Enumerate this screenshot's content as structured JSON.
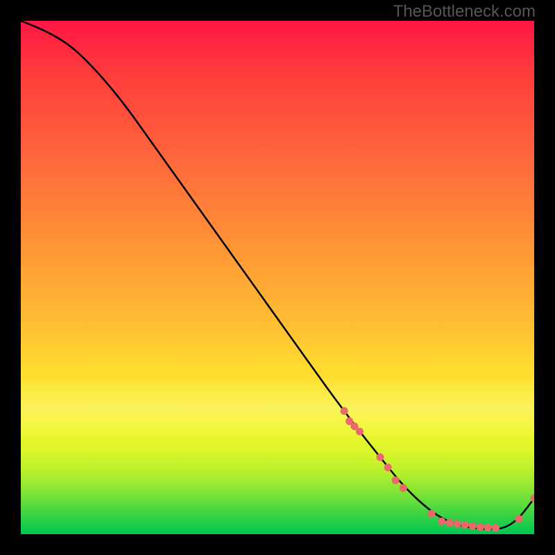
{
  "watermark": "TheBottleneck.com",
  "chart_data": {
    "type": "line",
    "title": "",
    "xlabel": "",
    "ylabel": "",
    "xlim": [
      0,
      100
    ],
    "ylim": [
      0,
      100
    ],
    "series": [
      {
        "name": "curve",
        "x": [
          0,
          5,
          10,
          15,
          20,
          25,
          30,
          35,
          40,
          45,
          50,
          55,
          60,
          63,
          66,
          70,
          74,
          78,
          82,
          86,
          90,
          94,
          97,
          100
        ],
        "y": [
          100,
          98,
          95,
          90,
          84,
          77,
          70,
          63,
          56,
          49,
          42,
          35,
          28,
          24,
          20,
          15,
          10,
          6,
          3,
          1.5,
          1,
          1,
          3,
          7
        ]
      }
    ],
    "markers": [
      {
        "x": 63,
        "y": 24
      },
      {
        "x": 64,
        "y": 22
      },
      {
        "x": 65,
        "y": 21
      },
      {
        "x": 66,
        "y": 20
      },
      {
        "x": 70,
        "y": 15
      },
      {
        "x": 71.5,
        "y": 13
      },
      {
        "x": 73,
        "y": 10.5
      },
      {
        "x": 74.5,
        "y": 9
      },
      {
        "x": 80,
        "y": 4
      },
      {
        "x": 82,
        "y": 2.5
      },
      {
        "x": 83.5,
        "y": 2.2
      },
      {
        "x": 85,
        "y": 2.0
      },
      {
        "x": 86.5,
        "y": 1.8
      },
      {
        "x": 88,
        "y": 1.6
      },
      {
        "x": 89.5,
        "y": 1.4
      },
      {
        "x": 91,
        "y": 1.3
      },
      {
        "x": 92.5,
        "y": 1.2
      },
      {
        "x": 97,
        "y": 3
      },
      {
        "x": 100,
        "y": 7
      }
    ],
    "marker_color": "#e96a6a",
    "line_color": "#000000"
  }
}
